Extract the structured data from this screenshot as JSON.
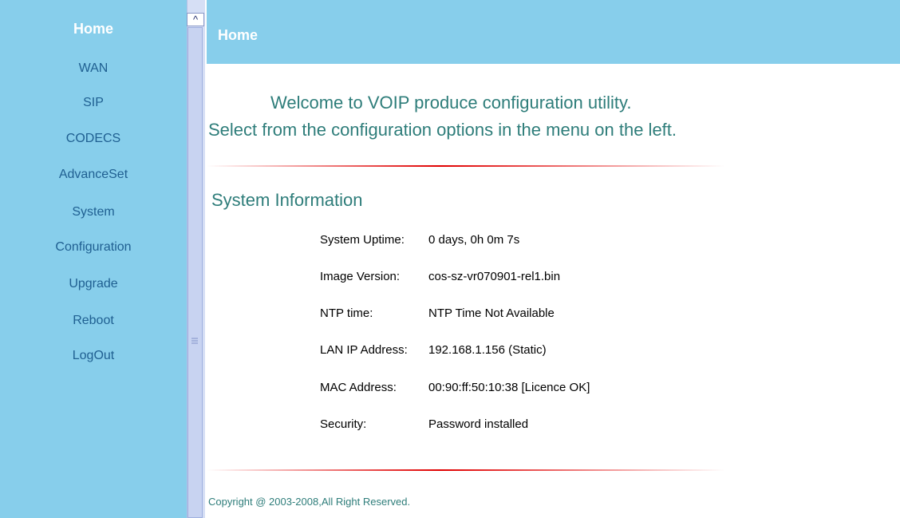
{
  "sidebar": {
    "home": "Home",
    "items": [
      {
        "label": "WAN"
      },
      {
        "label": "SIP"
      },
      {
        "label": "CODECS"
      },
      {
        "label": "AdvanceSet"
      },
      {
        "label": "System"
      },
      {
        "label": "Configuration"
      },
      {
        "label": "Upgrade"
      },
      {
        "label": "Reboot"
      },
      {
        "label": "LogOut"
      }
    ]
  },
  "header": {
    "title": "Home"
  },
  "welcome": {
    "line1": "Welcome to VOIP produce configuration utility.",
    "line2": "Select from the configuration options in the menu on the left."
  },
  "system_info": {
    "title": "System Information",
    "rows": [
      {
        "label": "System Uptime:",
        "value": "0 days, 0h 0m 7s"
      },
      {
        "label": "Image Version:",
        "value": "cos-sz-vr070901-rel1.bin"
      },
      {
        "label": "NTP time:",
        "value": "NTP Time Not Available"
      },
      {
        "label": "LAN IP Address:",
        "value": "192.168.1.156 (Static)"
      },
      {
        "label": "MAC Address:",
        "value": "00:90:ff:50:10:38 [Licence OK]"
      },
      {
        "label": "Security:",
        "value": "Password installed"
      }
    ]
  },
  "footer": {
    "copyright": "Copyright @ 2003-2008,All Right Reserved."
  },
  "colors": {
    "sidebar_bg": "#87ceeb",
    "nav_text": "#1f5f91",
    "heading_text": "#2e7d7a",
    "divider": "#e00000"
  }
}
